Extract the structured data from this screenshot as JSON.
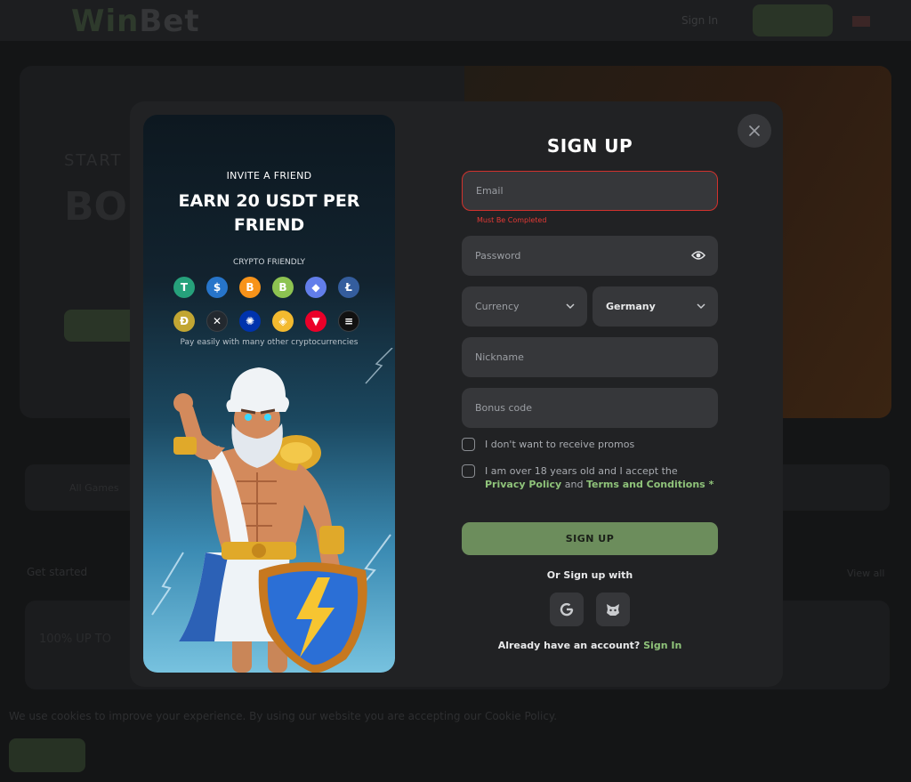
{
  "background": {
    "logo_part1": "Win",
    "logo_part2": "Bet",
    "header_signin": "Sign In",
    "hero_kicker": "START",
    "hero_title": "BONUS SPINS",
    "search_text": "All Games",
    "section_title": "Get started",
    "section_view": "View all",
    "card_text": "100% UP TO",
    "cookie_text": "We use cookies to improve your experience. By using our website you are accepting our Cookie Policy."
  },
  "promo": {
    "kicker": "INVITE A FRIEND",
    "title": "EARN 20 USDT PER FRIEND",
    "crypto_label": "CRYPTO FRIENDLY",
    "pay_text": "Pay easily with many other cryptocurrencies",
    "coins": [
      {
        "name": "tether-icon",
        "glyph": "T",
        "color": "#26a17b"
      },
      {
        "name": "usdc-icon",
        "glyph": "$",
        "color": "#2775ca"
      },
      {
        "name": "bitcoin-icon",
        "glyph": "B",
        "color": "#f7931a"
      },
      {
        "name": "bitcoin-cash-icon",
        "glyph": "B",
        "color": "#8dc351"
      },
      {
        "name": "ethereum-icon",
        "glyph": "◆",
        "color": "#627eea"
      },
      {
        "name": "litecoin-icon",
        "glyph": "Ł",
        "color": "#345d9d"
      },
      {
        "name": "dogecoin-icon",
        "glyph": "Ð",
        "color": "#c2a633"
      },
      {
        "name": "xrp-icon",
        "glyph": "✕",
        "color": "#23292f"
      },
      {
        "name": "cardano-icon",
        "glyph": "✺",
        "color": "#0033ad"
      },
      {
        "name": "bnb-icon",
        "glyph": "◈",
        "color": "#f3ba2f"
      },
      {
        "name": "tron-icon",
        "glyph": "▼",
        "color": "#eb0029"
      },
      {
        "name": "solana-icon",
        "glyph": "≡",
        "color": "#111111"
      }
    ]
  },
  "form": {
    "title": "SIGN UP",
    "email_placeholder": "Email",
    "email_error": "Must Be Completed",
    "password_placeholder": "Password",
    "currency_placeholder": "Currency",
    "country_value": "Germany",
    "nickname_placeholder": "Nickname",
    "bonus_placeholder": "Bonus code",
    "promo_opt_out": "I don't want to receive promos",
    "age_text_prefix": "I am over 18 years old and I accept the ",
    "privacy_link": "Privacy Policy",
    "and_text": " and ",
    "terms_link": "Terms and Conditions",
    "required_mark": " *",
    "submit_label": "SIGN UP",
    "or_signup_with": "Or Sign up with",
    "already_text": "Already have an account? ",
    "signin_link": "Sign In"
  },
  "colors": {
    "accent_green": "#8fc37a",
    "button_green": "#6c8d5c",
    "error_red": "#e53935"
  }
}
